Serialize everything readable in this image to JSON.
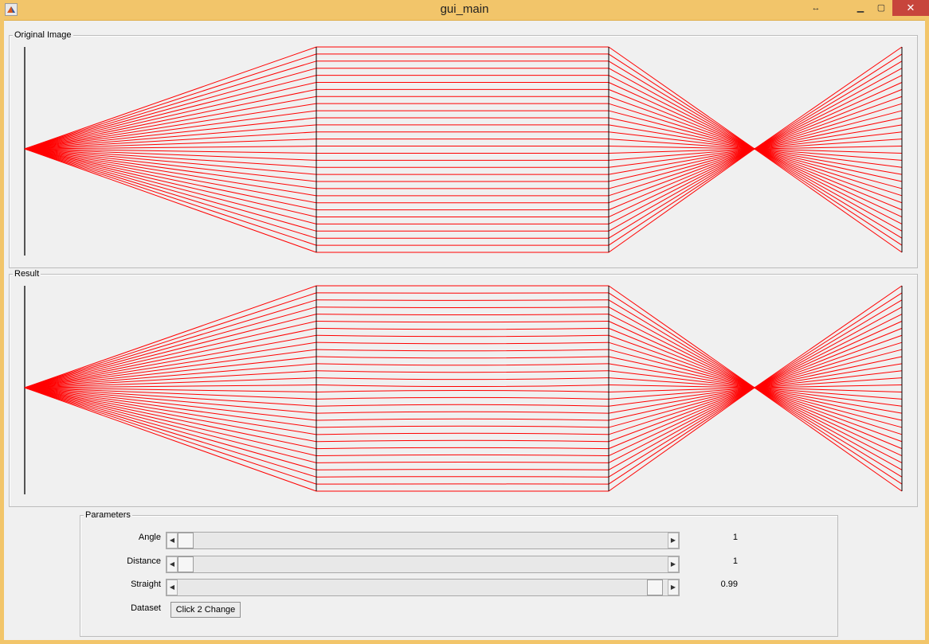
{
  "window": {
    "title": "gui_main"
  },
  "panels": {
    "original": {
      "title": "Original Image"
    },
    "result": {
      "title": "Result"
    },
    "parameters": {
      "title": "Parameters"
    }
  },
  "parameters": {
    "angle": {
      "label": "Angle",
      "value": "1",
      "fraction": 0.0
    },
    "distance": {
      "label": "Distance",
      "value": "1",
      "fraction": 0.0
    },
    "straight": {
      "label": "Straight",
      "value": "0.99",
      "fraction": 0.99
    },
    "dataset": {
      "label": "Dataset",
      "button_label": "Click 2 Change"
    }
  },
  "colors": {
    "ray": "#ff0000",
    "lens": "#000000",
    "accent": "#f2c56a"
  }
}
